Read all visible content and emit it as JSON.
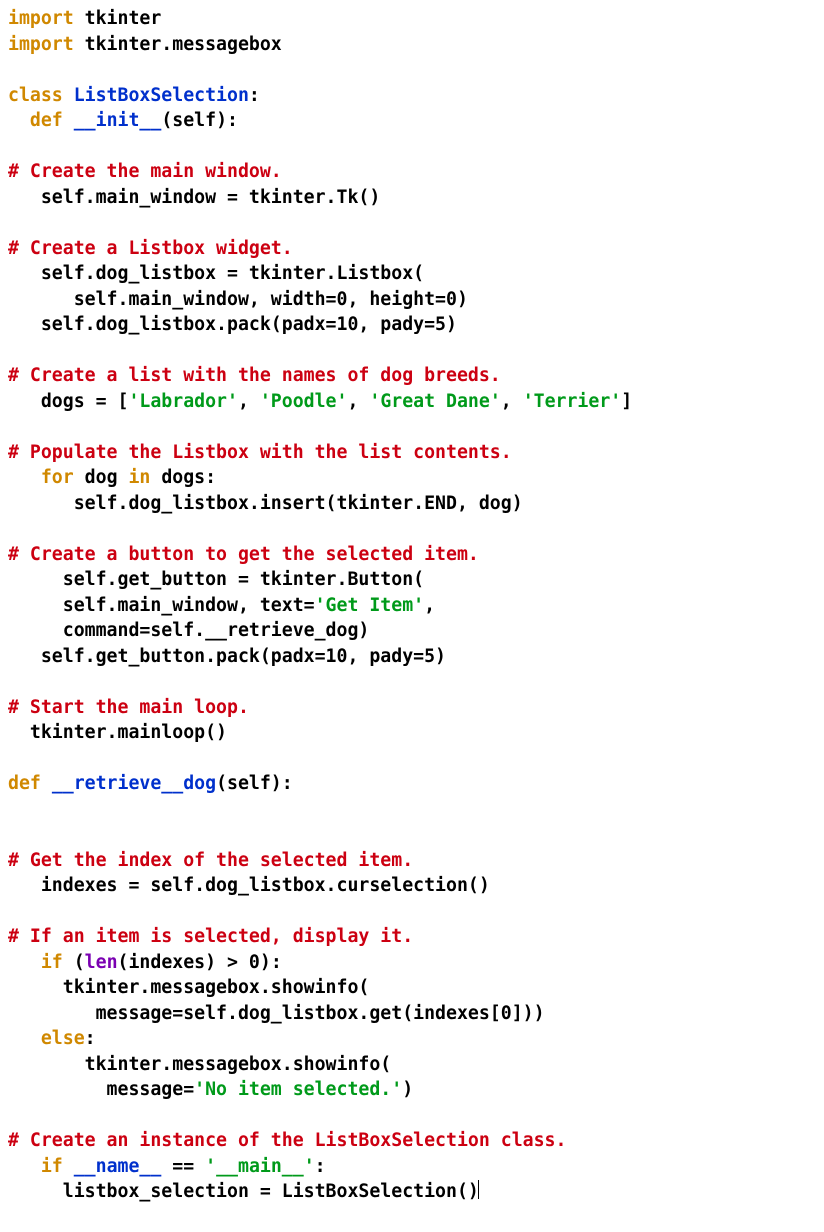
{
  "code": {
    "lines": [
      [
        {
          "cls": "tok-kw",
          "t": "import"
        },
        {
          "t": " tkinter"
        }
      ],
      [
        {
          "cls": "tok-kw",
          "t": "import"
        },
        {
          "t": " tkinter.messagebox"
        }
      ],
      [],
      [
        {
          "cls": "tok-kw",
          "t": "class"
        },
        {
          "t": " "
        },
        {
          "cls": "tok-cls",
          "t": "ListBoxSelection"
        },
        {
          "t": ":"
        }
      ],
      [
        {
          "t": "  "
        },
        {
          "cls": "tok-kw",
          "t": "def"
        },
        {
          "t": " "
        },
        {
          "cls": "tok-cls",
          "t": "__init__"
        },
        {
          "t": "(self):"
        }
      ],
      [],
      [
        {
          "cls": "tok-cmt",
          "t": "# Create the main window."
        }
      ],
      [
        {
          "t": "   self.main_window = tkinter.Tk()"
        }
      ],
      [],
      [
        {
          "cls": "tok-cmt",
          "t": "# Create a Listbox widget."
        }
      ],
      [
        {
          "t": "   self.dog_listbox = tkinter.Listbox("
        }
      ],
      [
        {
          "t": "      self.main_window, width=0, height=0)"
        }
      ],
      [
        {
          "t": "   self.dog_listbox.pack(padx=10, pady=5)"
        }
      ],
      [],
      [
        {
          "cls": "tok-cmt",
          "t": "# Create a list with the names of dog breeds."
        }
      ],
      [
        {
          "t": "   dogs = ["
        },
        {
          "cls": "tok-str",
          "t": "'Labrador'"
        },
        {
          "t": ", "
        },
        {
          "cls": "tok-str",
          "t": "'Poodle'"
        },
        {
          "t": ", "
        },
        {
          "cls": "tok-str",
          "t": "'Great Dane'"
        },
        {
          "t": ", "
        },
        {
          "cls": "tok-str",
          "t": "'Terrier'"
        },
        {
          "t": "]"
        }
      ],
      [],
      [
        {
          "cls": "tok-cmt",
          "t": "# Populate the Listbox with the list contents."
        }
      ],
      [
        {
          "t": "   "
        },
        {
          "cls": "tok-kw",
          "t": "for"
        },
        {
          "t": " dog "
        },
        {
          "cls": "tok-kw",
          "t": "in"
        },
        {
          "t": " dogs:"
        }
      ],
      [
        {
          "t": "      self.dog_listbox.insert(tkinter.END, dog)"
        }
      ],
      [],
      [
        {
          "cls": "tok-cmt",
          "t": "# Create a button to get the selected item."
        }
      ],
      [
        {
          "t": "     self.get_button = tkinter.Button("
        }
      ],
      [
        {
          "t": "     self.main_window, text="
        },
        {
          "cls": "tok-str",
          "t": "'Get Item'"
        },
        {
          "t": ","
        }
      ],
      [
        {
          "t": "     command=self.__retrieve_dog)"
        }
      ],
      [
        {
          "t": "   self.get_button.pack(padx=10, pady=5)"
        }
      ],
      [],
      [
        {
          "cls": "tok-cmt",
          "t": "# Start the main loop."
        }
      ],
      [
        {
          "t": "  tkinter.mainloop()"
        }
      ],
      [],
      [
        {
          "cls": "tok-kw",
          "t": "def"
        },
        {
          "t": " "
        },
        {
          "cls": "tok-cls",
          "t": "__retrieve__dog"
        },
        {
          "t": "(self):"
        }
      ],
      [],
      [],
      [
        {
          "cls": "tok-cmt",
          "t": "# Get the index of the selected item."
        }
      ],
      [
        {
          "t": "   indexes = self.dog_listbox.curselection()"
        }
      ],
      [],
      [
        {
          "cls": "tok-cmt",
          "t": "# If an item is selected, display it."
        }
      ],
      [
        {
          "t": "   "
        },
        {
          "cls": "tok-kw",
          "t": "if"
        },
        {
          "t": " ("
        },
        {
          "cls": "tok-builtin",
          "t": "len"
        },
        {
          "t": "(indexes) > 0):"
        }
      ],
      [
        {
          "t": "     tkinter.messagebox.showinfo("
        }
      ],
      [
        {
          "t": "        message=self.dog_listbox.get(indexes[0]))"
        }
      ],
      [
        {
          "t": "   "
        },
        {
          "cls": "tok-kw",
          "t": "else"
        },
        {
          "t": ":"
        }
      ],
      [
        {
          "t": "       tkinter.messagebox.showinfo("
        }
      ],
      [
        {
          "t": "         message="
        },
        {
          "cls": "tok-str",
          "t": "'No item selected.'"
        },
        {
          "t": ")"
        }
      ],
      [],
      [
        {
          "cls": "tok-cmt",
          "t": "# Create an instance of the ListBoxSelection class."
        }
      ],
      [
        {
          "t": "   "
        },
        {
          "cls": "tok-kw",
          "t": "if"
        },
        {
          "t": " "
        },
        {
          "cls": "tok-cls",
          "t": "__name__"
        },
        {
          "t": " == "
        },
        {
          "cls": "tok-str",
          "t": "'__main__'"
        },
        {
          "t": ":"
        }
      ],
      [
        {
          "t": "     listbox_selection = ListBoxSelection()"
        },
        {
          "cursor": true
        }
      ]
    ]
  }
}
